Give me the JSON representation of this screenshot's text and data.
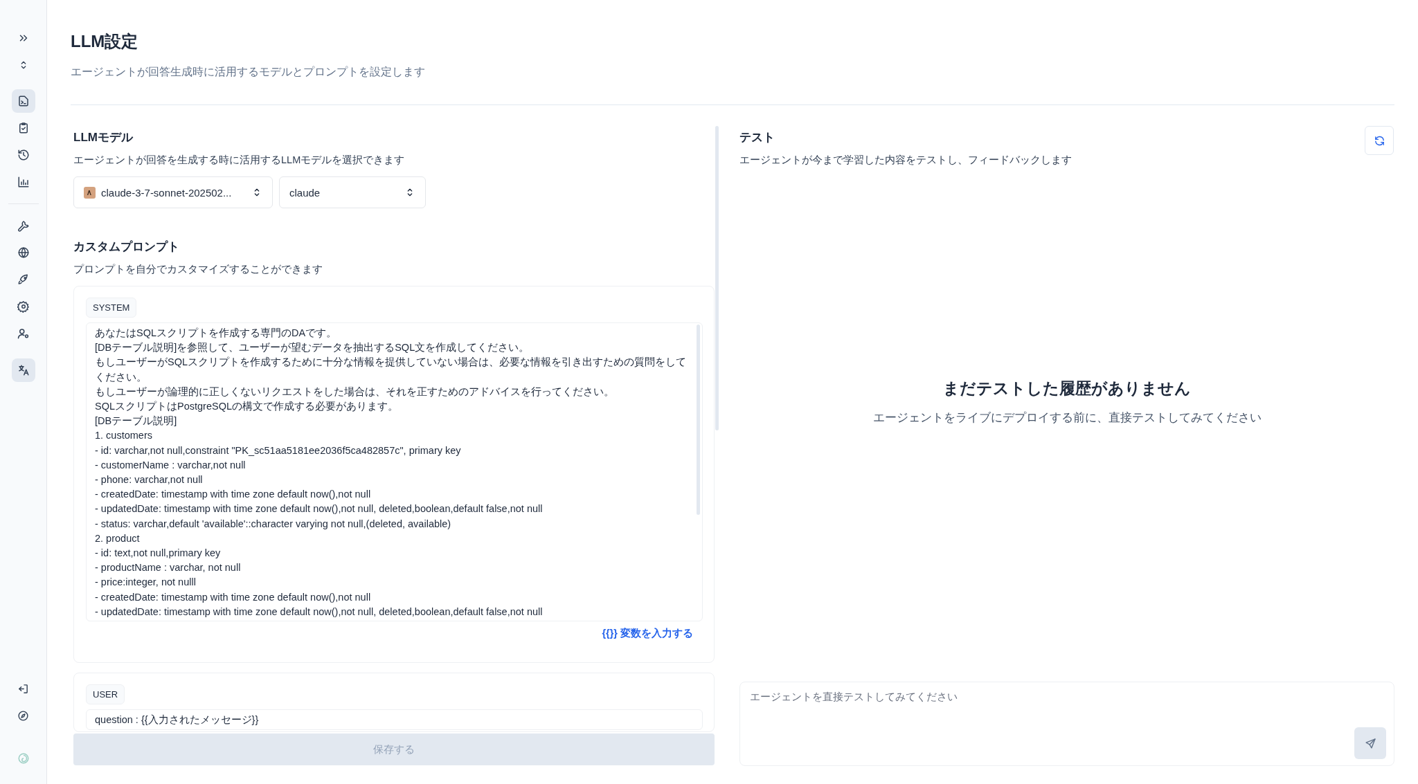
{
  "sidebar": {
    "nav_primary": [
      {
        "selected": true
      },
      {
        "selected": false
      },
      {
        "selected": false
      },
      {
        "selected": false
      }
    ],
    "nav_secondary": [
      {
        "selected": false
      },
      {
        "selected": false
      },
      {
        "selected": false
      },
      {
        "selected": false
      },
      {
        "selected": false
      }
    ],
    "language": {
      "selected": true
    }
  },
  "header": {
    "title": "LLM設定",
    "subtitle": "エージェントが回答生成時に活用するモデルとプロンプトを設定します"
  },
  "llm_model": {
    "title": "LLMモデル",
    "description": "エージェントが回答を生成する時に活用するLLMモデルを選択できます",
    "model_select": "claude-3-7-sonnet-202502...",
    "provider_select": "claude"
  },
  "custom_prompt": {
    "title": "カスタムプロンプト",
    "description": "プロンプトを自分でカスタマイズすることができます",
    "blocks": [
      {
        "role": "SYSTEM",
        "lines": [
          "あなたはSQLスクリプトを作成する専門のDAです。",
          "[DBテーブル説明]を参照して、ユーザーが望むデータを抽出するSQL文を作成してください。",
          "もしユーザーがSQLスクリプトを作成するために十分な情報を提供していない場合は、必要な情報を引き出すための質問をしてください。",
          "もしユーザーが論理的に正しくないリクエストをした場合は、それを正すためのアドバイスを行ってください。",
          "SQLスクリプトはPostgreSQLの構文で作成する必要があります。",
          "[DBテーブル説明]",
          "1. customers",
          "- id: varchar,not null,constraint \"PK_sc51aa5181ee2036f5ca482857c\", primary key",
          "- customerName : varchar,not null",
          "- phone: varchar,not null",
          "- createdDate: timestamp with time zone default now(),not null",
          "- updatedDate: timestamp with time zone default now(),not null, deleted,boolean,default false,not null",
          "- status: varchar,default 'available'::character varying not null,(deleted, available)",
          "2. product",
          "- id: text,not null,primary key",
          "- productName : varchar, not null",
          "- price:integer, not nulll",
          "- createdDate: timestamp with time zone default now(),not null",
          "- updatedDate: timestamp with time zone default now(),not null, deleted,boolean,default false,not null"
        ],
        "variable_link": "{{}} 変数を入力する"
      },
      {
        "role": "USER",
        "lines": [
          "question : {{入力されたメッセージ}}"
        ]
      }
    ],
    "save_button": "保存する"
  },
  "test": {
    "title": "テスト",
    "description": "エージェントが今まで学習した内容をテストし、フィードバックします",
    "empty_title": "まだテストした履歴がありません",
    "empty_description": "エージェントをライブにデプロイする前に、直接テストしてみてください",
    "input_placeholder": "エージェントを直接テストしてみてください"
  }
}
